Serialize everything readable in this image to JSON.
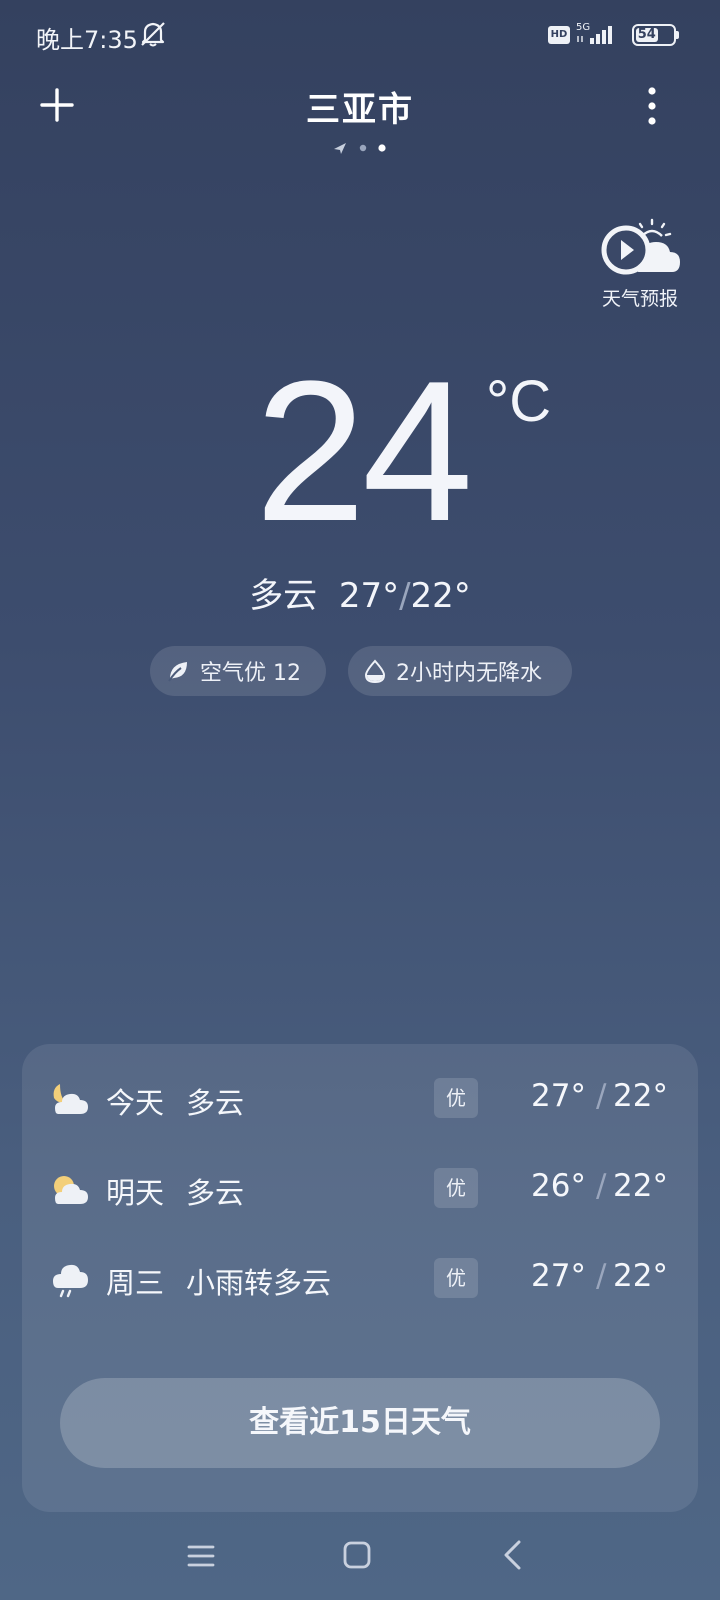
{
  "status_bar": {
    "time": "晚上7:35",
    "hd_label": "HD",
    "network": "5G",
    "battery": "54",
    "battery_level": 0.54
  },
  "header": {
    "city": "三亚市",
    "page_count": 3,
    "current_page": 2
  },
  "video_forecast": {
    "label": "天气预报"
  },
  "current": {
    "temperature": "24",
    "unit": "°C",
    "condition": "多云",
    "high": "27°",
    "low": "22°"
  },
  "pills": {
    "aqi": "空气优 12",
    "rain": "2小时内无降水"
  },
  "forecast": [
    {
      "day": "今天",
      "condition": "多云",
      "aqi": "优",
      "high": "27°",
      "low": "22°",
      "icon": "moon-cloud-icon"
    },
    {
      "day": "明天",
      "condition": "多云",
      "aqi": "优",
      "high": "26°",
      "low": "22°",
      "icon": "sun-cloud-icon"
    },
    {
      "day": "周三",
      "condition": "小雨转多云",
      "aqi": "优",
      "high": "27°",
      "low": "22°",
      "icon": "rain-cloud-icon"
    }
  ],
  "forecast_button": "查看近15日天气",
  "colors": {
    "background_top": "#34415f",
    "background_bottom": "#4f6786",
    "text": "#f3f5fa",
    "muted": "#9aa6bd"
  }
}
